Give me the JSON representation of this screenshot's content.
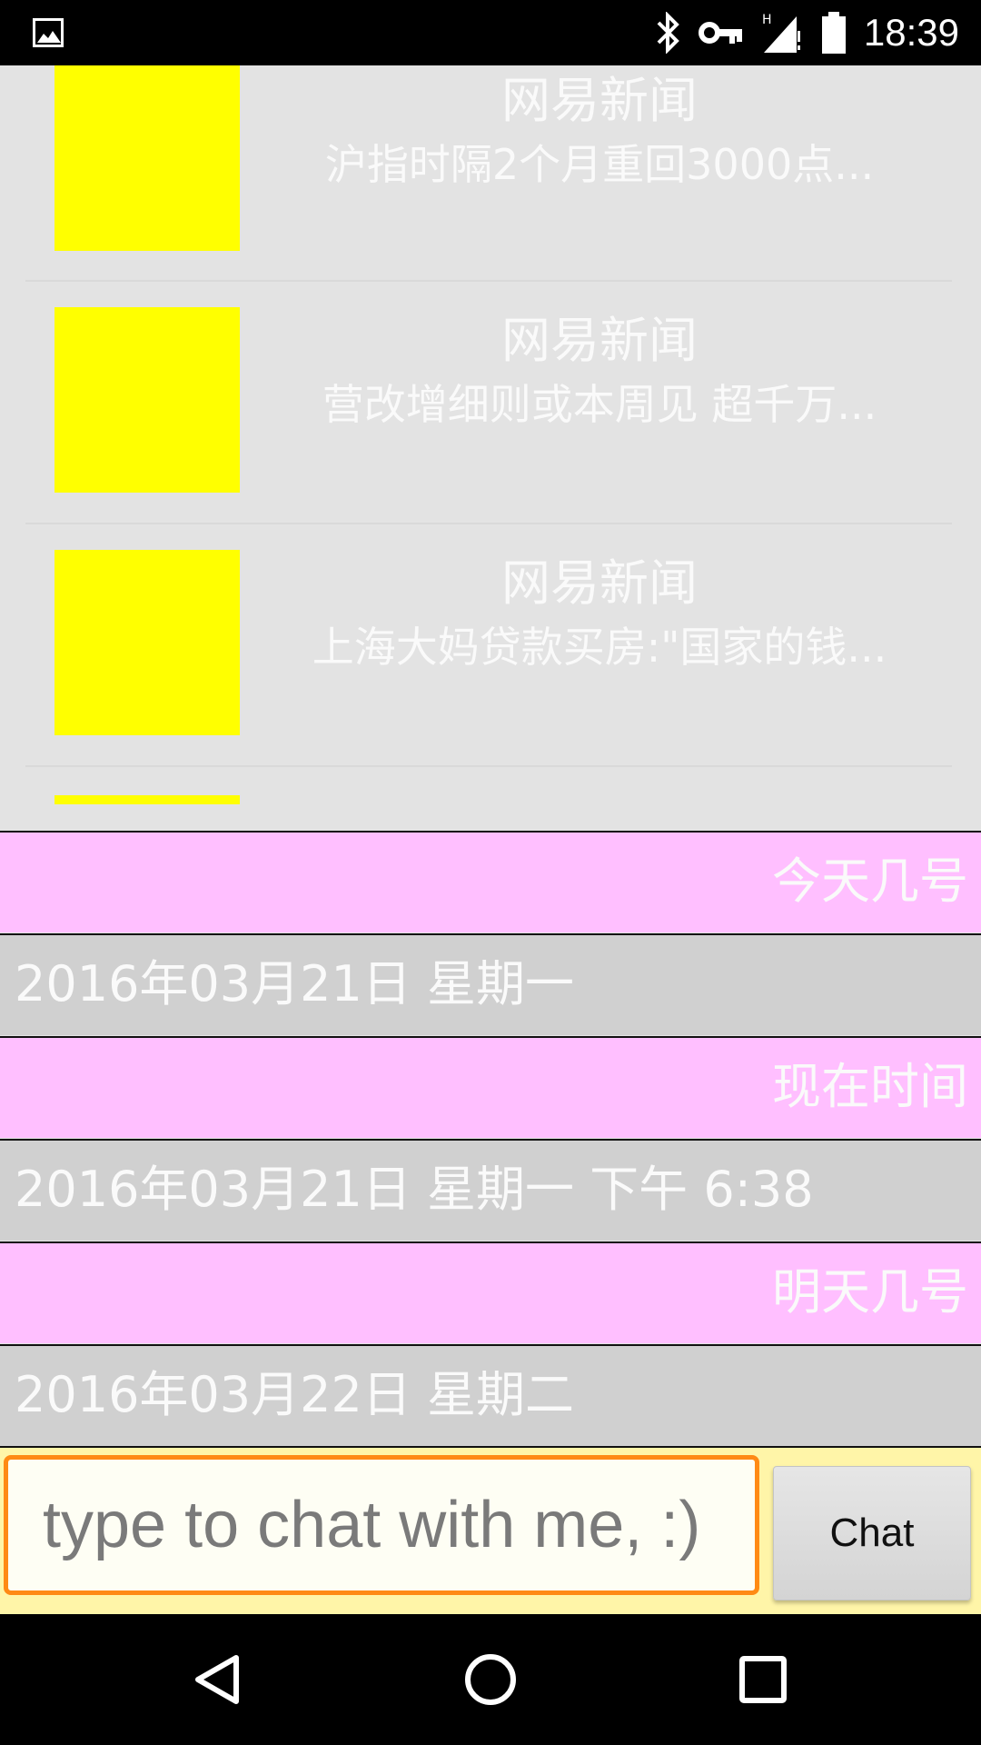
{
  "status_bar": {
    "time": "18:39",
    "icons": [
      "gallery-icon",
      "bluetooth-icon",
      "vpn-key-icon",
      "signal-h-icon",
      "battery-icon"
    ]
  },
  "news": {
    "items": [
      {
        "source": "网易新闻",
        "headline": "沪指时隔2个月重回3000点..."
      },
      {
        "source": "网易新闻",
        "headline": "营改增细则或本周见 超千万..."
      },
      {
        "source": "网易新闻",
        "headline": "上海大妈贷款买房:\"国家的钱..."
      }
    ],
    "thumb_color": "#ffff00"
  },
  "chat": {
    "messages": [
      {
        "role": "user",
        "text": "今天几号"
      },
      {
        "role": "bot",
        "text": "2016年03月21日  星期一"
      },
      {
        "role": "user",
        "text": "现在时间"
      },
      {
        "role": "bot",
        "text": "2016年03月21日 星期一 下午 6:38"
      },
      {
        "role": "user",
        "text": "明天几号"
      },
      {
        "role": "bot",
        "text": "2016年03月22日  星期二"
      }
    ],
    "user_bg": "#ffbfff",
    "bot_bg": "#d0d0d0"
  },
  "input": {
    "placeholder": "type to chat with me, :)",
    "value": "",
    "button_label": "Chat",
    "accent": "#ff8a14"
  },
  "nav": {
    "buttons": [
      "back-icon",
      "home-icon",
      "recents-icon"
    ]
  }
}
